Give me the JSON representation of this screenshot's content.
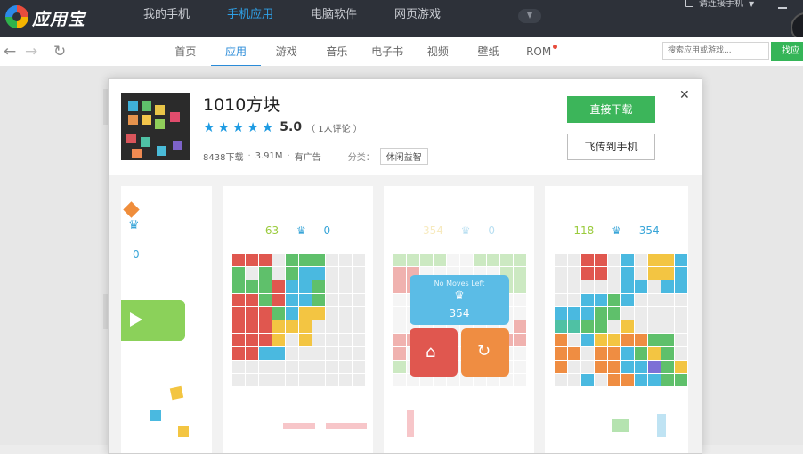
{
  "topbar": {
    "logo_text": "应用宝",
    "nav": [
      {
        "label": "我的手机",
        "active": false
      },
      {
        "label": "手机应用",
        "active": true
      },
      {
        "label": "电脑软件",
        "active": false
      },
      {
        "label": "网页游戏",
        "active": false
      }
    ],
    "connect_label": "请连接手机"
  },
  "subbar": {
    "tabs": [
      {
        "label": "首页",
        "active": false
      },
      {
        "label": "应用",
        "active": true
      },
      {
        "label": "游戏",
        "active": false
      },
      {
        "label": "音乐",
        "active": false
      },
      {
        "label": "电子书",
        "active": false
      },
      {
        "label": "视频",
        "active": false
      },
      {
        "label": "壁纸",
        "active": false
      },
      {
        "label": "ROM",
        "active": false
      }
    ],
    "search_placeholder": "搜索应用或游戏...",
    "search_button": "找应用"
  },
  "app": {
    "title": "1010方块",
    "rating": "5.0",
    "stars": 5,
    "reviews": "（ 1人评论 ）",
    "downloads": "8438下载",
    "size": "3.91M",
    "ads": "有广告",
    "category_label": "分类：",
    "category": "休闲益智",
    "download_button": "直接下载",
    "send_button": "飞传到手机"
  },
  "screenshots": {
    "card1": {
      "score": "0"
    },
    "card2": {
      "score_left": "63",
      "score_right": "0"
    },
    "card3": {
      "score_left": "354",
      "score_right": "0",
      "popup_title": "No Moves Left",
      "popup_score": "354"
    },
    "card4": {
      "score_left": "118",
      "score_right": "354"
    }
  },
  "colors": {
    "accent_blue": "#2a8bd8",
    "download_green": "#3cb55a",
    "topbar": "#2d3139"
  }
}
